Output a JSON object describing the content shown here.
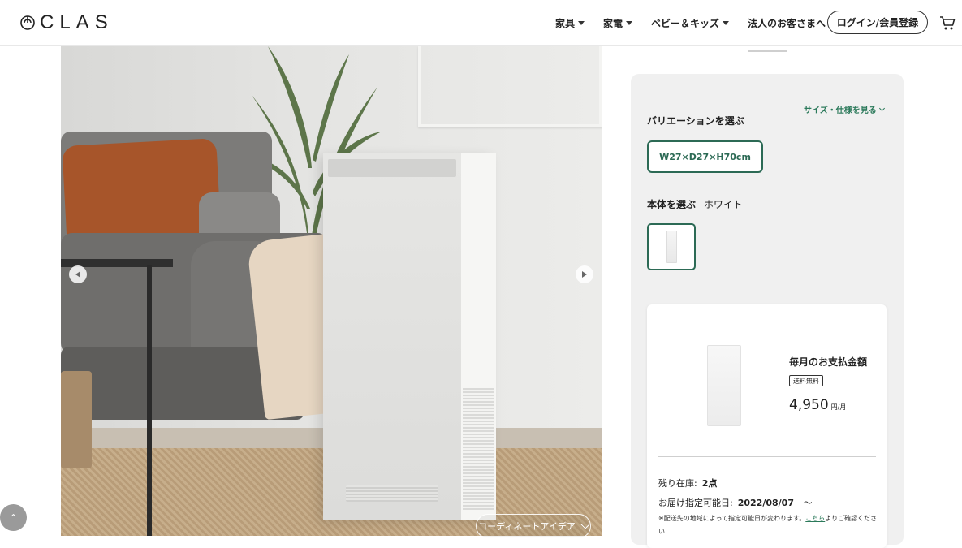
{
  "header": {
    "logo_text": "CLAS",
    "nav": [
      {
        "label": "家具",
        "has_dropdown": true
      },
      {
        "label": "家電",
        "has_dropdown": true
      },
      {
        "label": "ベビー＆キッズ",
        "has_dropdown": true
      },
      {
        "label": "法人のお客さまへ",
        "has_dropdown": false
      }
    ],
    "login_label": "ログイン/会員登録",
    "cart_icon": "cart-icon"
  },
  "gallery": {
    "prev_icon": "chevron-left-icon",
    "next_icon": "chevron-right-icon",
    "coordinate_label": "コーディネートアイデア"
  },
  "scroll_top_icon": "chevron-up-icon",
  "product": {
    "size_link": "サイズ・仕様を見る",
    "variation_label": "バリエーションを選ぶ",
    "variation_value": "W27×D27×H70cm",
    "body_label": "本体を選ぶ",
    "body_color": "ホワイト"
  },
  "price_card": {
    "title": "毎月のお支払金額",
    "shipping_badge": "送料無料",
    "price": "4,950",
    "price_unit": "円/月",
    "stock_label": "残り在庫:",
    "stock_value": "2点",
    "delivery_label": "お届け指定可能日:",
    "delivery_value": "2022/08/07",
    "delivery_suffix": "〜",
    "note_before": "※配送先の地域によって指定可能日が変わります。",
    "note_link": "こちら",
    "note_after": "よりご確認ください"
  },
  "colors": {
    "accent": "#2c6a55",
    "link": "#2c7a5b",
    "panel_bg": "#f0f0f0"
  }
}
